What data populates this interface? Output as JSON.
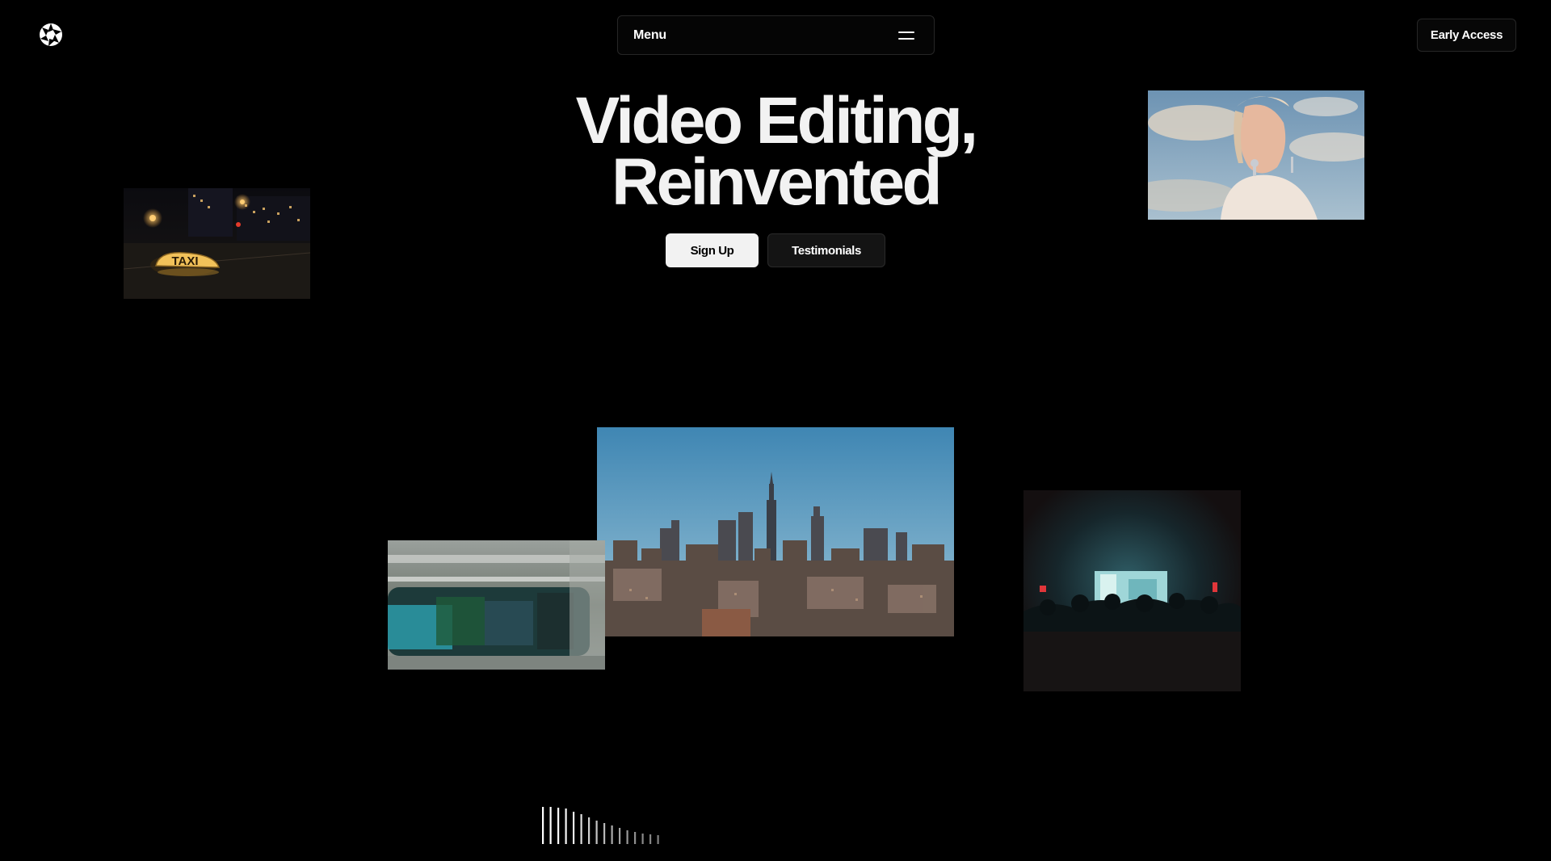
{
  "header": {
    "logo_icon": "aperture-logo-icon",
    "menu_label": "Menu",
    "menu_icon": "hamburger-icon",
    "early_access_label": "Early Access"
  },
  "hero": {
    "title_line1": "Video Editing,",
    "title_line2": "Reinvented",
    "signup_label": "Sign Up",
    "testimonials_label": "Testimonials"
  },
  "media": [
    {
      "name": "taxi-night-clip",
      "subject": "taxi sign at night",
      "sign_text": "TAXI"
    },
    {
      "name": "portrait-clip",
      "subject": "woman against cloudy sky"
    },
    {
      "name": "skyline-clip",
      "subject": "city skyline at dusk"
    },
    {
      "name": "train-clip",
      "subject": "motion-blurred subway train"
    },
    {
      "name": "concert-clip",
      "subject": "concert crowd and stage screen"
    }
  ],
  "audio_meter": {
    "icon": "audio-waveform-icon",
    "levels": [
      1,
      1,
      0.98,
      0.95,
      0.88,
      0.8,
      0.72,
      0.64,
      0.57,
      0.5,
      0.44,
      0.38,
      0.33,
      0.29,
      0.26,
      0.24
    ]
  },
  "colors": {
    "background": "#000000",
    "primary_button": "#f2f2f2",
    "secondary_button": "#141414",
    "text": "#ffffff"
  }
}
